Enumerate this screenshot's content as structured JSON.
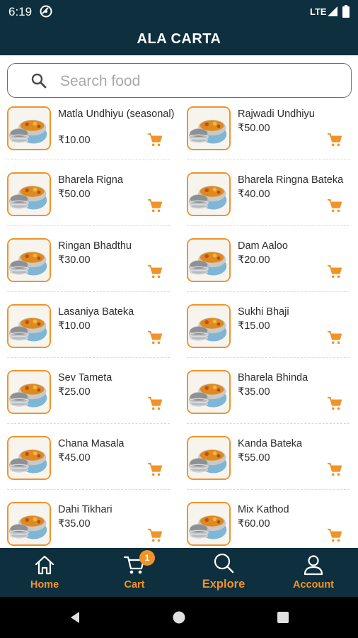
{
  "status_bar": {
    "time": "6:19",
    "network": "LTE"
  },
  "app_bar": {
    "title": "ALA CARTA"
  },
  "search": {
    "placeholder": "Search food"
  },
  "items": [
    {
      "name": "Matla Undhiyu (seasonal)",
      "price": "₹10.00"
    },
    {
      "name": "Rajwadi Undhiyu",
      "price": "₹50.00"
    },
    {
      "name": "Bharela Rigna",
      "price": "₹50.00"
    },
    {
      "name": "Bharela Ringna Bateka",
      "price": "₹40.00"
    },
    {
      "name": "Ringan Bhadthu",
      "price": "₹30.00"
    },
    {
      "name": "Dam Aaloo",
      "price": "₹20.00"
    },
    {
      "name": "Lasaniya Bateka",
      "price": "₹10.00"
    },
    {
      "name": "Sukhi Bhaji",
      "price": "₹15.00"
    },
    {
      "name": "Sev Tameta",
      "price": "₹25.00"
    },
    {
      "name": "Bharela Bhinda",
      "price": "₹35.00"
    },
    {
      "name": "Chana Masala",
      "price": "₹45.00"
    },
    {
      "name": "Kanda Bateka",
      "price": "₹55.00"
    },
    {
      "name": "Dahi Tikhari",
      "price": "₹35.00"
    },
    {
      "name": "Mix Kathod",
      "price": "₹60.00"
    }
  ],
  "bottom_nav": {
    "home": "Home",
    "cart": "Cart",
    "cart_badge": "1",
    "explore": "Explore",
    "account": "Account"
  },
  "colors": {
    "header_bg": "#0e2f3d",
    "accent": "#f0942a"
  }
}
